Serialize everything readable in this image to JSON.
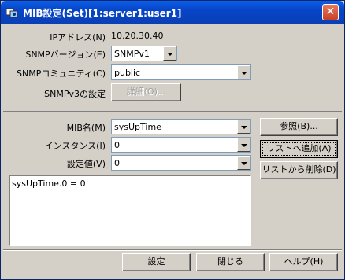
{
  "window": {
    "title": "MIB設定(Set)[1:server1:user1]"
  },
  "top": {
    "ip_label": "IPアドレス(N)",
    "ip_value": "10.20.30.40",
    "snmp_version_label": "SNMPバージョン(E)",
    "snmp_version_value": "SNMPv1",
    "community_label": "SNMPコミュニティ(C)",
    "community_value": "public",
    "v3_label": "SNMPv3の設定",
    "v3_button": "詳細(O)..."
  },
  "mib": {
    "mib_name_label": "MIB名(M)",
    "mib_name_value": "sysUpTime",
    "instance_label": "インスタンス(I)",
    "instance_value": "0",
    "set_value_label": "設定値(V)",
    "set_value_value": "0",
    "browse_button": "参照(B)...",
    "add_button": "リストへ追加(A)",
    "remove_button": "リストから削除(D)",
    "list_items": [
      "sysUpTime.0 = 0"
    ]
  },
  "footer": {
    "set_button": "設定",
    "close_button": "閉じる",
    "help_button": "ヘルプ(H)"
  }
}
